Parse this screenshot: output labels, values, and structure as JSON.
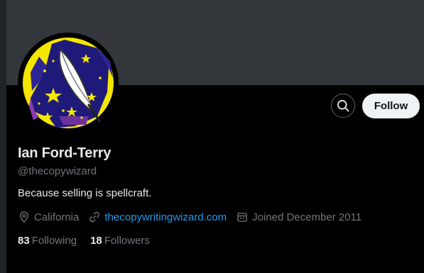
{
  "profile": {
    "name": "Ian Ford-Terry",
    "handle": "@thecopywizard",
    "bio": "Because selling is spellcraft.",
    "location": "California",
    "website": "thecopywritingwizard.com",
    "joined": "Joined December 2011",
    "following_count": "83",
    "following_label": "Following",
    "followers_count": "18",
    "followers_label": "Followers"
  },
  "actions": {
    "follow_label": "Follow",
    "search_icon": "search-icon"
  },
  "icons": {
    "location": "location-pin-icon",
    "website": "link-icon",
    "joined": "calendar-icon"
  },
  "colors": {
    "background": "#000000",
    "banner": "#33363b",
    "link": "#1d9bf0",
    "secondary_text": "#71767b",
    "follow_button": "#eff3f4"
  }
}
